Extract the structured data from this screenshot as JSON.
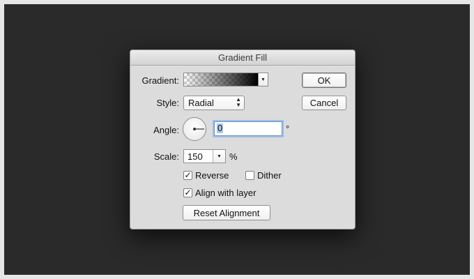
{
  "dialog": {
    "title": "Gradient Fill"
  },
  "gradient": {
    "label": "Gradient:",
    "arrow": "▼"
  },
  "style": {
    "label": "Style:",
    "value": "Radial",
    "updown": "▲▼"
  },
  "angle": {
    "label": "Angle:",
    "value": "0",
    "unit": "°"
  },
  "scale": {
    "label": "Scale:",
    "value": "150",
    "unit": "%",
    "arrow": "▼"
  },
  "options": {
    "reverse": {
      "label": "Reverse",
      "checked": true,
      "mark": "✓"
    },
    "dither": {
      "label": "Dither",
      "checked": false,
      "mark": ""
    },
    "align_with_layer": {
      "label": "Align with layer",
      "checked": true,
      "mark": "✓"
    }
  },
  "buttons": {
    "ok": "OK",
    "cancel": "Cancel",
    "reset_alignment": "Reset Alignment"
  },
  "colors": {
    "backdrop": "#2a2a2a",
    "dialog_bg": "#dcdcdc",
    "focus_ring": "#9fc0e8",
    "selection": "#abc8ec"
  }
}
